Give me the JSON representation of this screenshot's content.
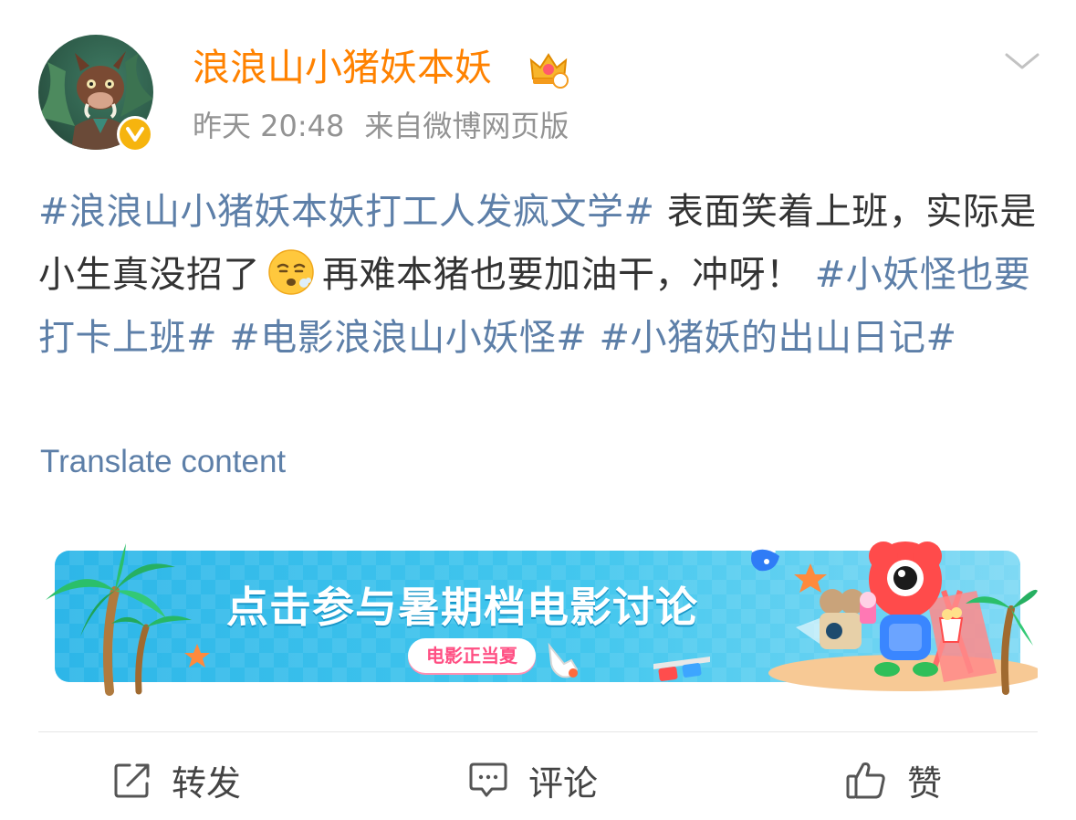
{
  "author": {
    "name": "浪浪山小猪妖本妖",
    "time": "昨天 20:48",
    "source": "来自微博网页版"
  },
  "post": {
    "segments": [
      {
        "type": "tag",
        "text": "#浪浪山小猪妖本妖打工人发疯文学#"
      },
      {
        "type": "text",
        "text": " 表面笑着上班，实际是小生真没招了"
      },
      {
        "type": "emoji",
        "icon": "exhausted-face-emoji"
      },
      {
        "type": "text",
        "text": "再难本猪也要加油干，冲呀！"
      },
      {
        "type": "tag",
        "text": " #小妖怪也要打卡上班#"
      },
      {
        "type": "tag",
        "text": " #电影浪浪山小妖怪#"
      },
      {
        "type": "tag",
        "text": " #小猪妖的出山日记#"
      }
    ],
    "translate_label": "Translate content"
  },
  "banner": {
    "title": "点击参与暑期档电影讨论",
    "badge": "电影正当夏"
  },
  "actions": {
    "repost": "转发",
    "comment": "评论",
    "like": "赞"
  },
  "colors": {
    "username": "#ff8200",
    "link": "#5d7fa8",
    "meta": "#939393",
    "verified": "#f6b40e"
  }
}
